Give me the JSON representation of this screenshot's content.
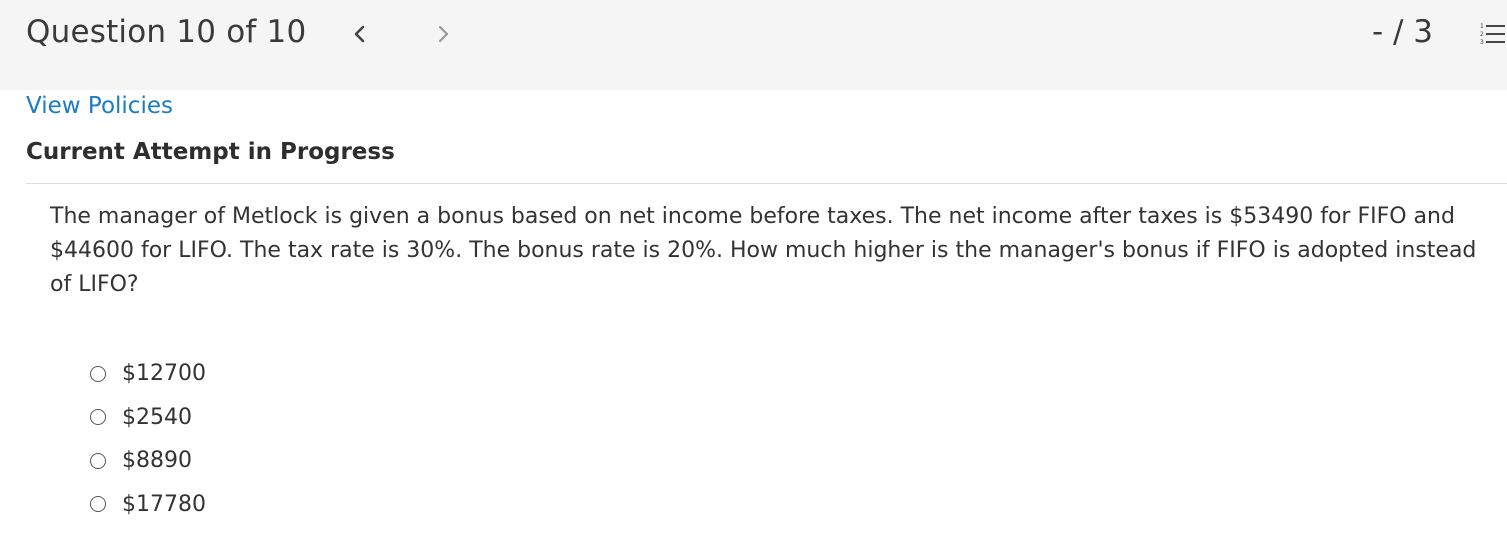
{
  "header": {
    "question_counter": "Question 10 of 10",
    "score": "- / 3",
    "prev_icon": "chevron-left-icon",
    "next_icon": "chevron-right-icon",
    "list_icon": "numbered-list-icon"
  },
  "policies_link": "View Policies",
  "attempt_status": "Current Attempt in Progress",
  "question": {
    "text": "The manager of Metlock is given a bonus based on net income before taxes. The net income after taxes is $53490 for FIFO and $44600 for LIFO. The tax rate is 30%. The bonus rate is 20%. How much higher is the manager's bonus if FIFO is adopted instead of LIFO?",
    "options": [
      {
        "label": "$12700"
      },
      {
        "label": "$2540"
      },
      {
        "label": "$8890"
      },
      {
        "label": "$17780"
      }
    ]
  },
  "colors": {
    "link": "#1a7cc1",
    "header_bg": "#f5f5f5",
    "content_bg": "#ffffff"
  }
}
